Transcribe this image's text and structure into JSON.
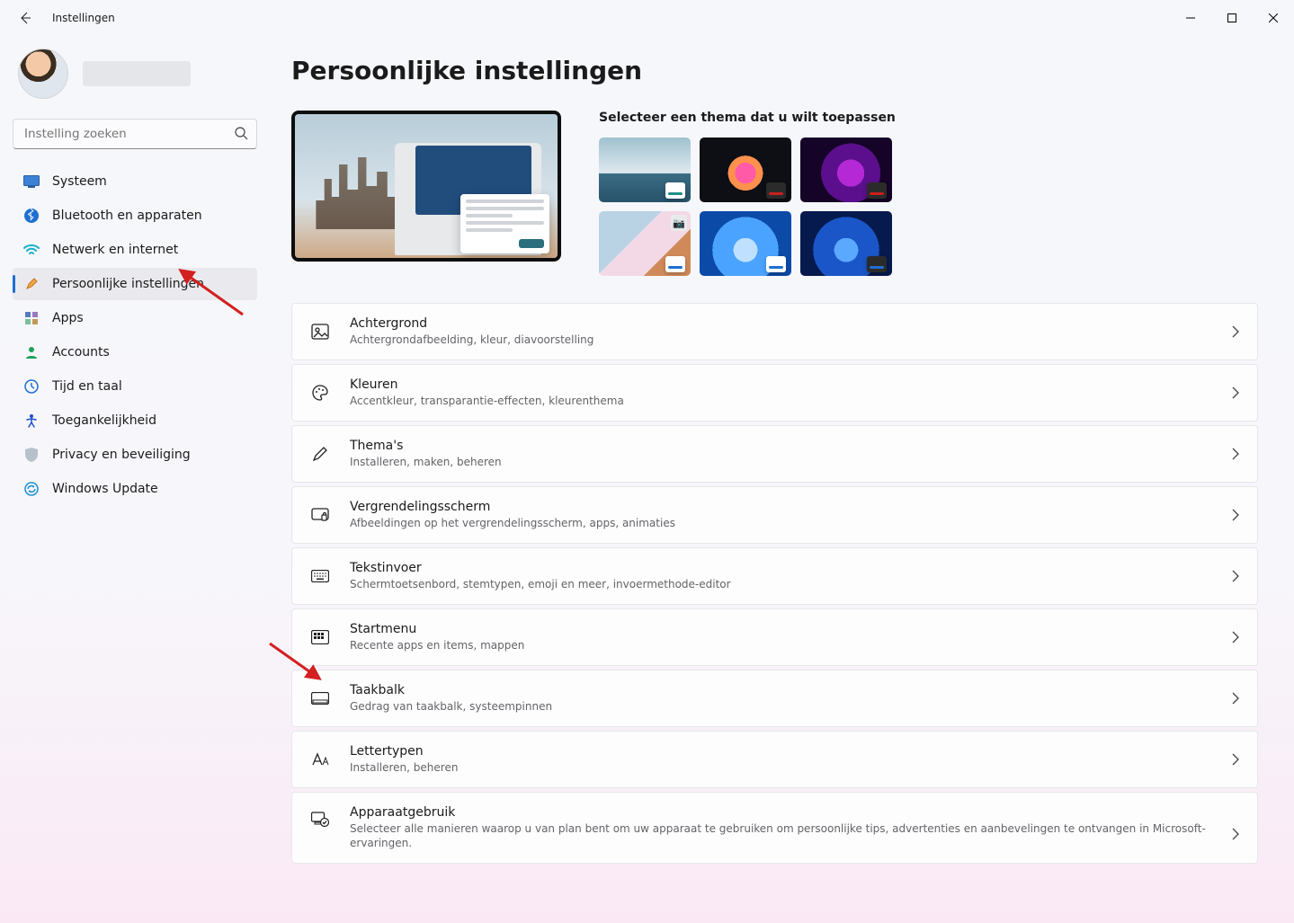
{
  "app": {
    "title": "Instellingen"
  },
  "search": {
    "placeholder": "Instelling zoeken"
  },
  "sidebar": {
    "items": [
      {
        "label": "Systeem"
      },
      {
        "label": "Bluetooth en apparaten"
      },
      {
        "label": "Netwerk en internet"
      },
      {
        "label": "Persoonlijke instellingen"
      },
      {
        "label": "Apps"
      },
      {
        "label": "Accounts"
      },
      {
        "label": "Tijd en taal"
      },
      {
        "label": "Toegankelijkheid"
      },
      {
        "label": "Privacy en beveiliging"
      },
      {
        "label": "Windows Update"
      }
    ]
  },
  "page": {
    "title": "Persoonlijke instellingen",
    "themes_heading": "Selecteer een thema dat u wilt toepassen"
  },
  "cards": [
    {
      "title": "Achtergrond",
      "sub": "Achtergrondafbeelding, kleur, diavoorstelling"
    },
    {
      "title": "Kleuren",
      "sub": "Accentkleur, transparantie-effecten, kleurenthema"
    },
    {
      "title": "Thema's",
      "sub": "Installeren, maken, beheren"
    },
    {
      "title": "Vergrendelingsscherm",
      "sub": "Afbeeldingen op het vergrendelingsscherm, apps, animaties"
    },
    {
      "title": "Tekstinvoer",
      "sub": "Schermtoetsenbord, stemtypen, emoji en meer, invoermethode-editor"
    },
    {
      "title": "Startmenu",
      "sub": "Recente apps en items, mappen"
    },
    {
      "title": "Taakbalk",
      "sub": "Gedrag van taakbalk, systeempinnen"
    },
    {
      "title": "Lettertypen",
      "sub": "Installeren, beheren"
    },
    {
      "title": "Apparaatgebruik",
      "sub": "Selecteer alle manieren waarop u van plan bent om uw apparaat te gebruiken om persoonlijke tips, advertenties en aanbevelingen te ontvangen in Microsoft-ervaringen."
    }
  ]
}
